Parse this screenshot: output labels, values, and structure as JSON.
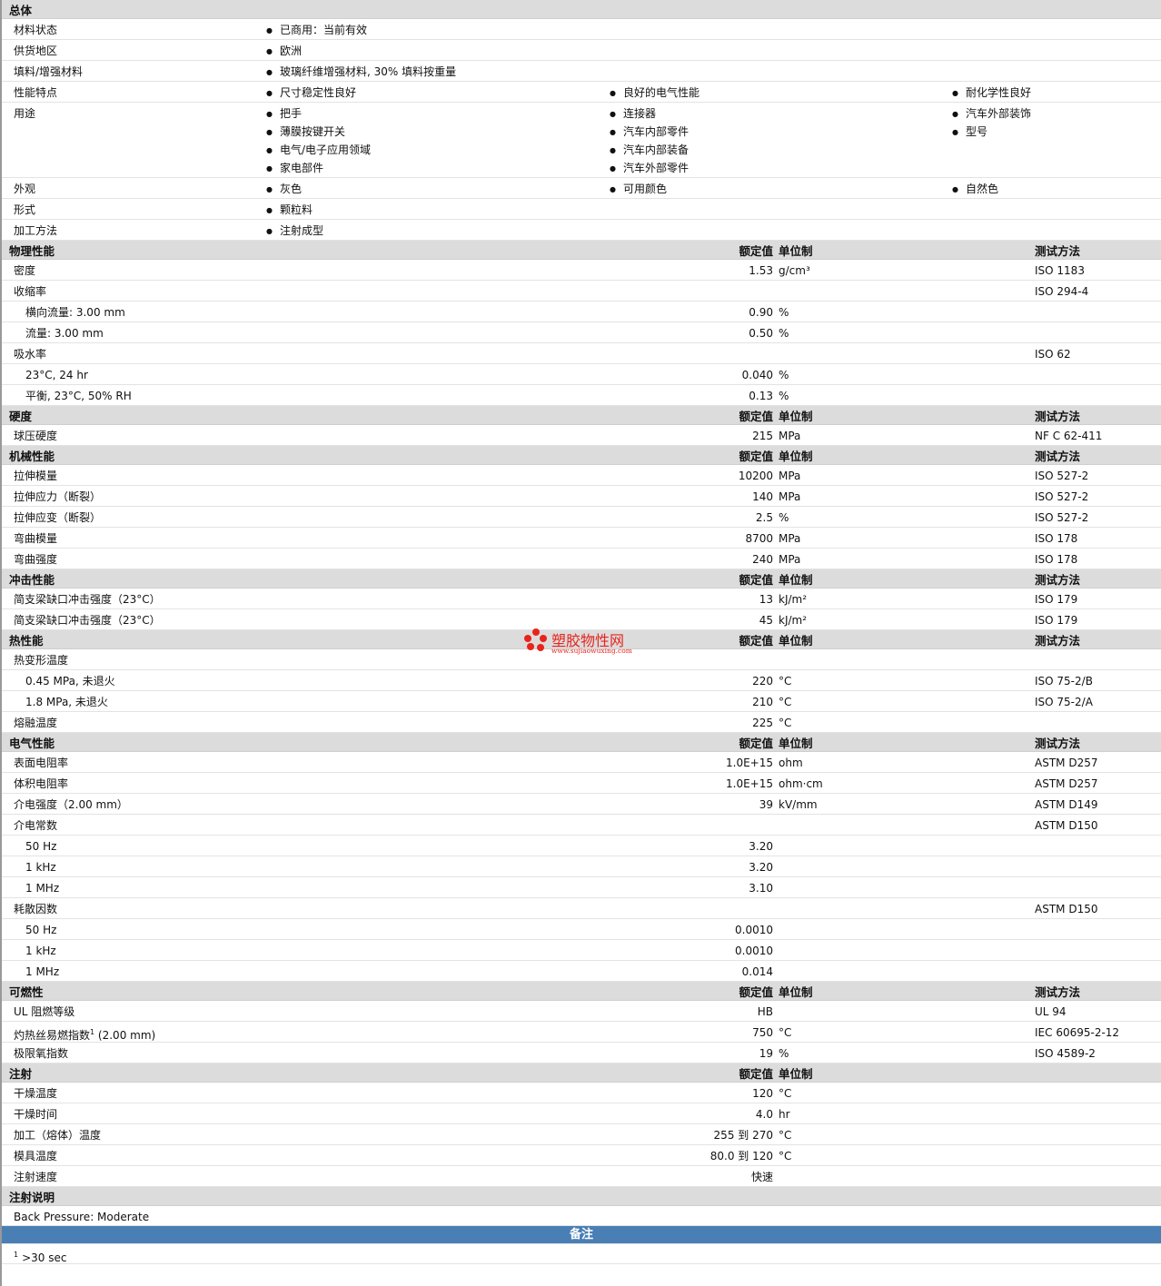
{
  "general": {
    "title": "总体",
    "rows": [
      {
        "label": "材料状态",
        "cols": [
          [
            "已商用：当前有效"
          ]
        ]
      },
      {
        "label": "供货地区",
        "cols": [
          [
            "欧洲"
          ]
        ]
      },
      {
        "label": "填料/增强材料",
        "cols": [
          [
            "玻璃纤维增强材料, 30% 填料按重量"
          ]
        ]
      },
      {
        "label": "性能特点",
        "cols": [
          [
            "尺寸稳定性良好"
          ],
          [
            "良好的电气性能"
          ],
          [
            "耐化学性良好"
          ]
        ]
      },
      {
        "label": "用途",
        "cols": [
          [
            "把手",
            "薄膜按键开关",
            "电气/电子应用领域",
            "家电部件"
          ],
          [
            "连接器",
            "汽车内部零件",
            "汽车内部装备",
            "汽车外部零件"
          ],
          [
            "汽车外部装饰",
            "型号"
          ]
        ]
      },
      {
        "label": "外观",
        "cols": [
          [
            "灰色"
          ],
          [
            "可用颜色"
          ],
          [
            "自然色"
          ]
        ]
      },
      {
        "label": "形式",
        "cols": [
          [
            "颗粒料"
          ]
        ]
      },
      {
        "label": "加工方法",
        "cols": [
          [
            "注射成型"
          ]
        ]
      }
    ]
  },
  "headers": {
    "value": "额定值",
    "unit": "单位制",
    "test": "测试方法"
  },
  "sections": [
    {
      "title": "物理性能",
      "show_test": true,
      "rows": [
        {
          "n": "密度",
          "v": "1.53",
          "u": "g/cm³",
          "t": "ISO 1183",
          "lv": 1
        },
        {
          "n": "收缩率",
          "v": "",
          "u": "",
          "t": "ISO 294-4",
          "lv": 1
        },
        {
          "n": "横向流量: 3.00 mm",
          "v": "0.90",
          "u": "%",
          "t": "",
          "lv": 2
        },
        {
          "n": "流量: 3.00 mm",
          "v": "0.50",
          "u": "%",
          "t": "",
          "lv": 2
        },
        {
          "n": "吸水率",
          "v": "",
          "u": "",
          "t": "ISO 62",
          "lv": 1
        },
        {
          "n": "23°C, 24 hr",
          "v": "0.040",
          "u": "%",
          "t": "",
          "lv": 2
        },
        {
          "n": "平衡, 23°C, 50% RH",
          "v": "0.13",
          "u": "%",
          "t": "",
          "lv": 2
        }
      ]
    },
    {
      "title": "硬度",
      "show_test": true,
      "rows": [
        {
          "n": "球压硬度",
          "v": "215",
          "u": "MPa",
          "t": "NF C 62-411",
          "lv": 1
        }
      ]
    },
    {
      "title": "机械性能",
      "show_test": true,
      "rows": [
        {
          "n": "拉伸模量",
          "v": "10200",
          "u": "MPa",
          "t": "ISO 527-2",
          "lv": 1
        },
        {
          "n": "拉伸应力（断裂）",
          "v": "140",
          "u": "MPa",
          "t": "ISO 527-2",
          "lv": 1
        },
        {
          "n": "拉伸应变（断裂）",
          "v": "2.5",
          "u": "%",
          "t": "ISO 527-2",
          "lv": 1
        },
        {
          "n": "弯曲模量",
          "v": "8700",
          "u": "MPa",
          "t": "ISO 178",
          "lv": 1
        },
        {
          "n": "弯曲强度",
          "v": "240",
          "u": "MPa",
          "t": "ISO 178",
          "lv": 1
        }
      ]
    },
    {
      "title": "冲击性能",
      "show_test": true,
      "rows": [
        {
          "n": "简支梁缺口冲击强度（23°C）",
          "v": "13",
          "u": "kJ/m²",
          "t": "ISO 179",
          "lv": 1
        },
        {
          "n": "简支梁缺口冲击强度（23°C）",
          "v": "45",
          "u": "kJ/m²",
          "t": "ISO 179",
          "lv": 1
        }
      ]
    },
    {
      "title": "热性能",
      "show_test": true,
      "rows": [
        {
          "n": "热变形温度",
          "v": "",
          "u": "",
          "t": "",
          "lv": 1
        },
        {
          "n": "0.45 MPa, 未退火",
          "v": "220",
          "u": "°C",
          "t": "ISO 75-2/B",
          "lv": 2
        },
        {
          "n": "1.8 MPa, 未退火",
          "v": "210",
          "u": "°C",
          "t": "ISO 75-2/A",
          "lv": 2
        },
        {
          "n": "熔融温度",
          "v": "225",
          "u": "°C",
          "t": "",
          "lv": 1
        }
      ]
    },
    {
      "title": "电气性能",
      "show_test": true,
      "rows": [
        {
          "n": "表面电阻率",
          "v": "1.0E+15",
          "u": "ohm",
          "t": "ASTM D257",
          "lv": 1
        },
        {
          "n": "体积电阻率",
          "v": "1.0E+15",
          "u": "ohm·cm",
          "t": "ASTM D257",
          "lv": 1
        },
        {
          "n": "介电强度（2.00 mm）",
          "v": "39",
          "u": "kV/mm",
          "t": "ASTM D149",
          "lv": 1
        },
        {
          "n": "介电常数",
          "v": "",
          "u": "",
          "t": "ASTM D150",
          "lv": 1
        },
        {
          "n": "50 Hz",
          "v": "3.20",
          "u": "",
          "t": "",
          "lv": 2
        },
        {
          "n": "1 kHz",
          "v": "3.20",
          "u": "",
          "t": "",
          "lv": 2
        },
        {
          "n": "1 MHz",
          "v": "3.10",
          "u": "",
          "t": "",
          "lv": 2
        },
        {
          "n": "耗散因数",
          "v": "",
          "u": "",
          "t": "ASTM D150",
          "lv": 1
        },
        {
          "n": "50 Hz",
          "v": "0.0010",
          "u": "",
          "t": "",
          "lv": 2
        },
        {
          "n": "1 kHz",
          "v": "0.0010",
          "u": "",
          "t": "",
          "lv": 2
        },
        {
          "n": "1 MHz",
          "v": "0.014",
          "u": "",
          "t": "",
          "lv": 2
        }
      ]
    },
    {
      "title": "可燃性",
      "show_test": true,
      "rows": [
        {
          "n": "UL 阻燃等级",
          "v": "HB",
          "u": "",
          "t": "UL 94",
          "lv": 1
        },
        {
          "n": "灼热丝易燃指数",
          "sup": "1",
          "n2": " (2.00 mm)",
          "v": "750",
          "u": "°C",
          "t": "IEC 60695-2-12",
          "lv": 1
        },
        {
          "n": "极限氧指数",
          "v": "19",
          "u": "%",
          "t": "ISO 4589-2",
          "lv": 1
        }
      ]
    },
    {
      "title": "注射",
      "show_test": false,
      "rows": [
        {
          "n": "干燥温度",
          "v": "120",
          "u": "°C",
          "t": "",
          "lv": 1
        },
        {
          "n": "干燥时间",
          "v": "4.0",
          "u": "hr",
          "t": "",
          "lv": 1
        },
        {
          "n": "加工（熔体）温度",
          "v": "255 到  270",
          "u": "°C",
          "t": "",
          "lv": 1
        },
        {
          "n": "模具温度",
          "v": "80.0 到  120",
          "u": "°C",
          "t": "",
          "lv": 1
        },
        {
          "n": "注射速度",
          "v": "快速",
          "u": "",
          "t": "",
          "lv": 1
        }
      ]
    }
  ],
  "notes": {
    "title": "注射说明",
    "text": "Back Pressure: Moderate"
  },
  "remarks": {
    "title": "备注",
    "sup": "1",
    "text": ">30 sec"
  },
  "watermark": {
    "cn": "塑胶物性网",
    "en": "www.sujiaowuxing.com",
    "color": "#e8241c"
  }
}
